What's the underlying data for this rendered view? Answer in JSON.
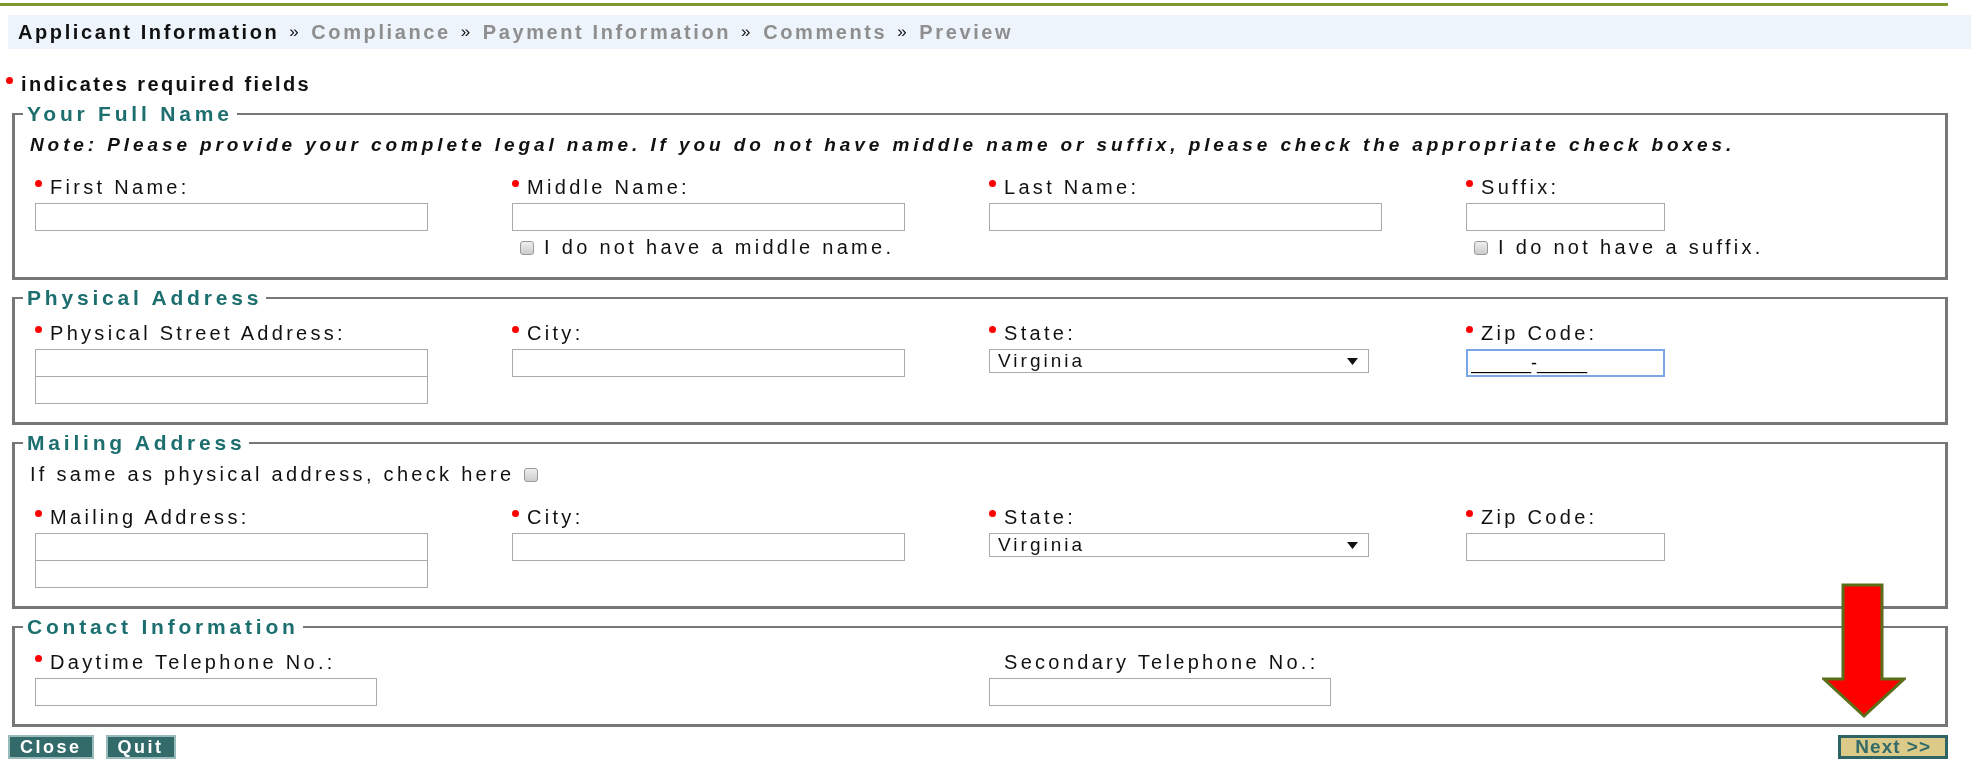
{
  "breadcrumb": [
    {
      "label": "Applicant Information",
      "selected": true
    },
    {
      "prefix": "»",
      "label": "Compliance",
      "selected": false
    },
    {
      "prefix": "»",
      "label": "Payment Information",
      "selected": false
    },
    {
      "prefix": "»",
      "label": "Comments",
      "selected": false
    },
    {
      "prefix": "»",
      "label": "Preview",
      "selected": false
    }
  ],
  "required_note": "indicates required fields",
  "sections": [
    {
      "legend": "Your Full Name",
      "note": "Note: Please provide your complete legal name. If you do not have middle name or suffix, please check the appropriate check boxes.",
      "fields": [
        {
          "label": "First Name:",
          "required": true,
          "kind": "text"
        },
        {
          "label": "Middle Name:",
          "required": true,
          "kind": "text",
          "checkbox": {
            "label": "I do not have a middle name.",
            "checked": false
          }
        },
        {
          "label": "Last Name:",
          "required": true,
          "kind": "text"
        },
        {
          "label": "Suffix:",
          "required": true,
          "kind": "short",
          "checkbox": {
            "label": "I do not have a suffix.",
            "checked": false
          }
        }
      ]
    },
    {
      "legend": "Physical Address",
      "fields": [
        {
          "label": "Physical Street Address:",
          "required": true,
          "kind": "address"
        },
        {
          "label": "City:",
          "required": true,
          "kind": "text"
        },
        {
          "label": "State:",
          "required": true,
          "kind": "select",
          "value": "Virginia"
        },
        {
          "label": "Zip Code:",
          "required": true,
          "kind": "short",
          "value": "______-_____",
          "focused": true
        }
      ]
    },
    {
      "legend": "Mailing Address",
      "same_as": {
        "label": "If same as physical address, check here",
        "checked": false
      },
      "fields": [
        {
          "label": "Mailing Address:",
          "required": true,
          "kind": "address"
        },
        {
          "label": "City:",
          "required": true,
          "kind": "text"
        },
        {
          "label": "State:",
          "required": true,
          "kind": "select",
          "value": "Virginia"
        },
        {
          "label": "Zip Code:",
          "required": true,
          "kind": "short"
        }
      ]
    },
    {
      "legend": "Contact Information",
      "fields": [
        {
          "label": "Daytime Telephone No.:",
          "required": true,
          "kind": "phone"
        },
        {
          "label": "Secondary Telephone No.:",
          "required": false,
          "kind": "phone"
        }
      ]
    }
  ],
  "buttons": [
    {
      "label": "Close",
      "kind": "plain"
    },
    {
      "label": "Quit",
      "kind": "plain"
    }
  ],
  "next_button": {
    "label": "Next >>"
  }
}
